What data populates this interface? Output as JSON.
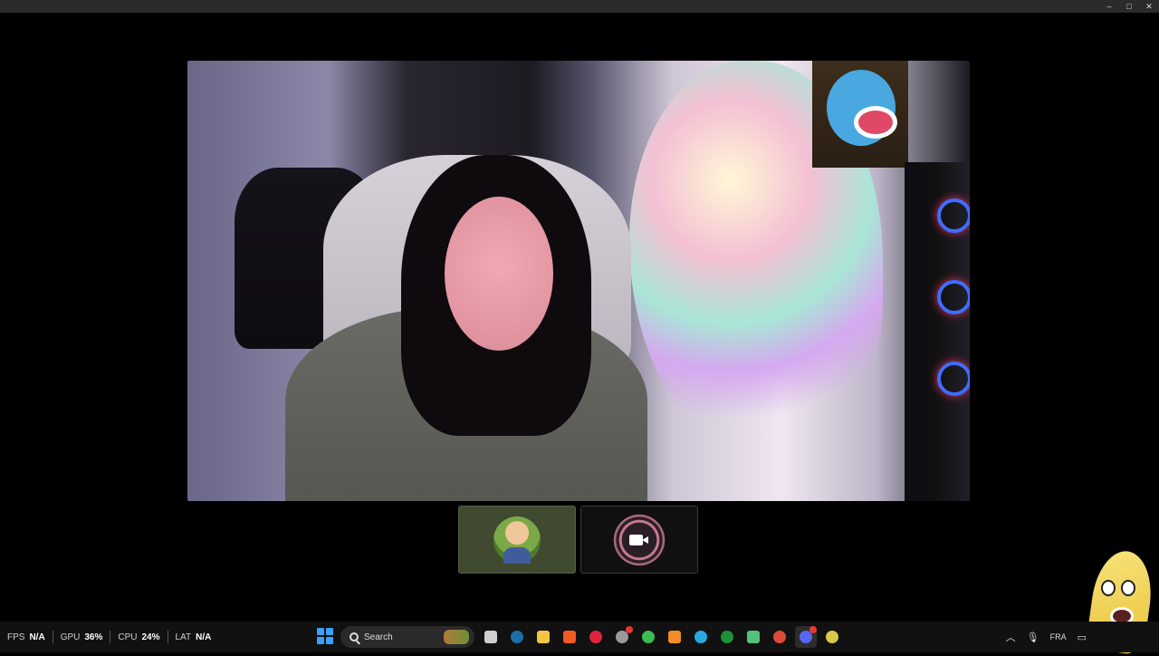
{
  "window": {
    "controls": {
      "minimize": "–",
      "maximize": "□",
      "close": "✕"
    }
  },
  "call": {
    "participants": [
      {
        "id": "main",
        "icon": "webcam-feed"
      },
      {
        "id": "thumb-1",
        "icon": "cartoon-avatar"
      },
      {
        "id": "thumb-2",
        "icon": "camera-icon"
      }
    ]
  },
  "overlay": {
    "stats": [
      {
        "label": "FPS",
        "value": "N/A"
      },
      {
        "label": "GPU",
        "value": "36%"
      },
      {
        "label": "CPU",
        "value": "24%"
      },
      {
        "label": "LAT",
        "value": "N/A"
      }
    ]
  },
  "taskbar": {
    "search_placeholder": "Search",
    "apps": [
      {
        "name": "task-view",
        "color": "#cfcfcf"
      },
      {
        "name": "steam",
        "color": "#1b6fa8"
      },
      {
        "name": "file-explorer",
        "color": "#f4c542"
      },
      {
        "name": "brave",
        "color": "#f15a24"
      },
      {
        "name": "opera",
        "color": "#e0243c"
      },
      {
        "name": "clock-app",
        "color": "#9a9a9a"
      },
      {
        "name": "chrome",
        "color": "#3cba54"
      },
      {
        "name": "photoshop-like",
        "color": "#f28c28"
      },
      {
        "name": "telegram",
        "color": "#2aa7df"
      },
      {
        "name": "xbox",
        "color": "#1f8f3a"
      },
      {
        "name": "media-player",
        "color": "#52c27a"
      },
      {
        "name": "chrome-2",
        "color": "#dd4b39"
      },
      {
        "name": "discord",
        "color": "#5865f2"
      },
      {
        "name": "smiley-app",
        "color": "#d6c94a"
      }
    ],
    "tray": {
      "language": "FRA"
    }
  },
  "colors": {
    "taskbar_bg": "#111111",
    "thumb_active_bg": "#3f4a30"
  }
}
